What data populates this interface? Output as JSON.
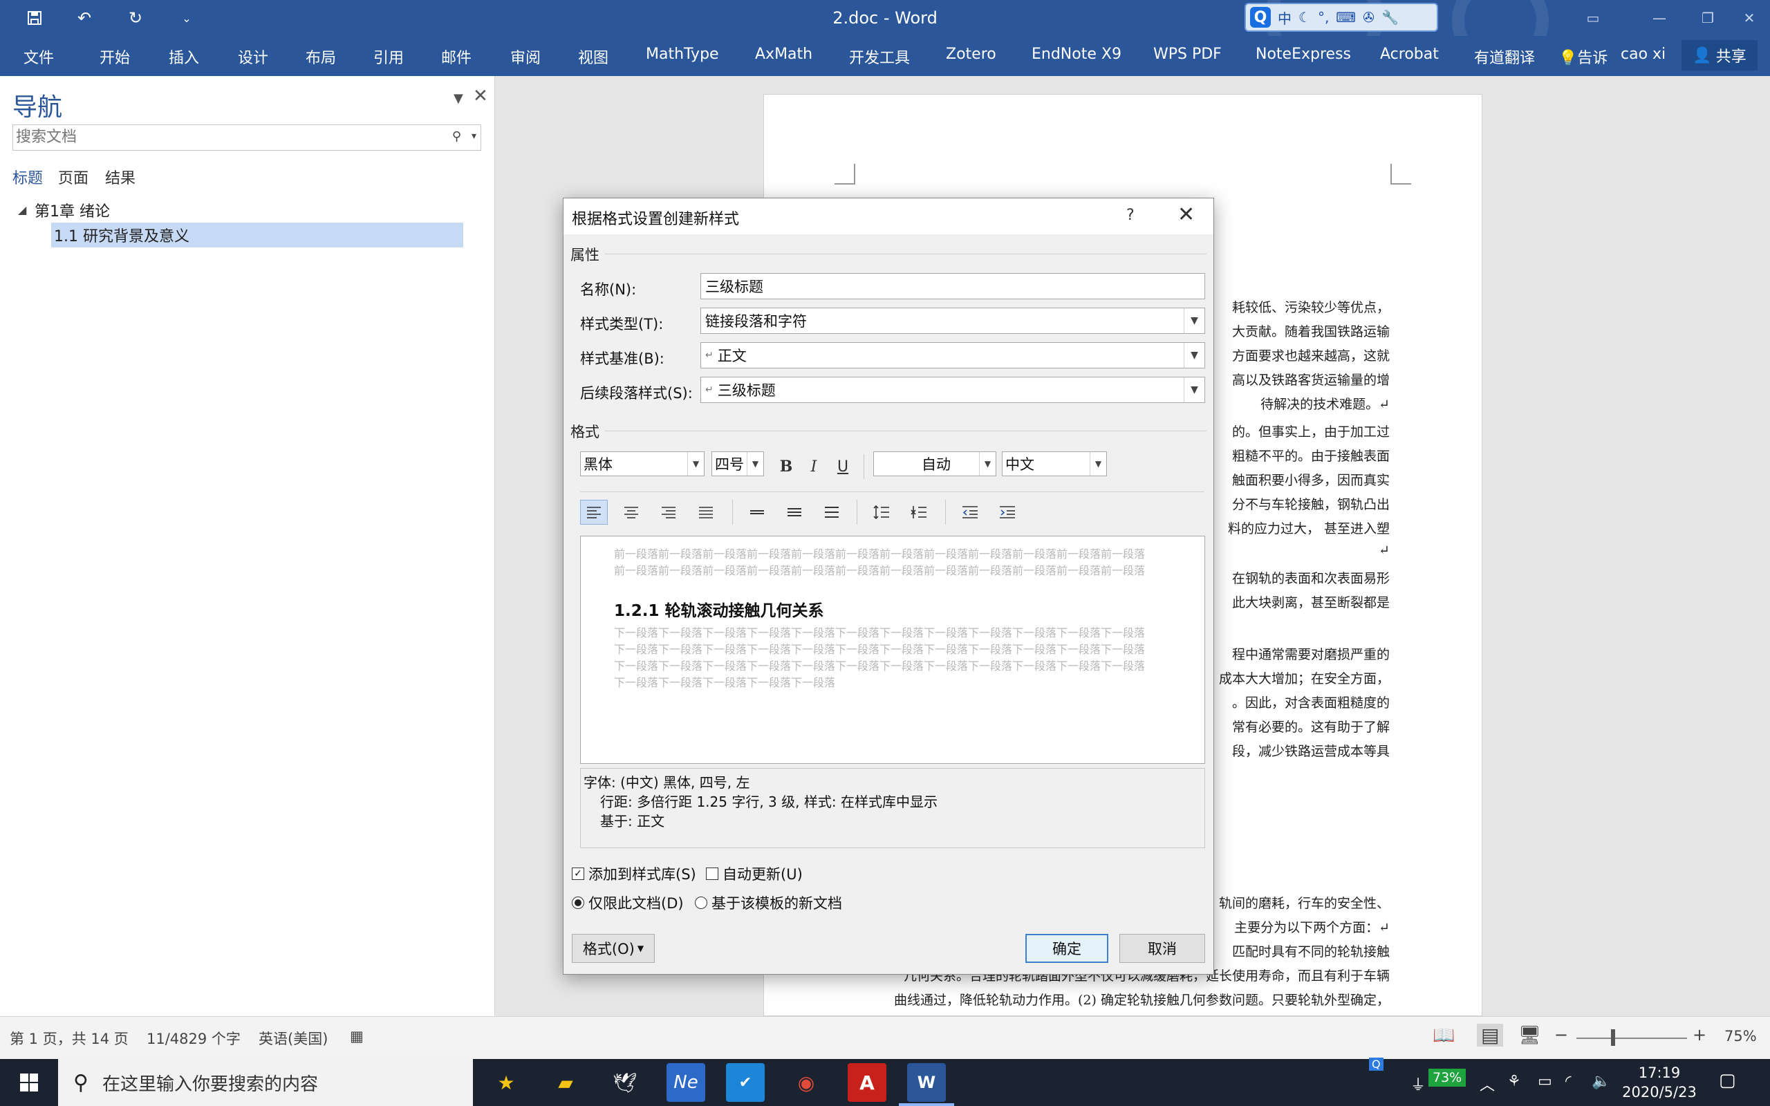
{
  "window": {
    "title": "2.doc - Word",
    "qa_more": "⌄"
  },
  "ime": {
    "q": "Q",
    "zh": "中"
  },
  "ribbon": {
    "tabs": [
      "文件",
      "开始",
      "插入",
      "设计",
      "布局",
      "引用",
      "邮件",
      "审阅",
      "视图",
      "MathType",
      "AxMath",
      "开发工具",
      "Zotero",
      "EndNote X9",
      "WPS PDF",
      "NoteExpress",
      "Acrobat",
      "有道翻译"
    ],
    "tell_me": "告诉",
    "user": "cao xi",
    "share": "共享"
  },
  "nav": {
    "title": "导航",
    "search_placeholder": "搜索文档",
    "tabs": [
      "标题",
      "页面",
      "结果"
    ],
    "tree": [
      {
        "label": "第1章 绪论"
      },
      {
        "label": "1.1 研究背景及意义"
      }
    ]
  },
  "doc": {
    "lines": [
      "耗较低、污染较少等优点，",
      "大贡献。随着我国铁路运输",
      "方面要求也越来越高，这就",
      "高以及铁路客货运输量的增",
      "待解决的技术难题。↵",
      "的。但事实上，由于加工过",
      "粗糙不平的。由于接触表面",
      "触面积要小得多，因而真实",
      "分不与车轮接触，钢轨凸出",
      "料的应力过大，  甚至进入塑",
      "↵",
      "在钢轨的表面和次表面易形",
      "此大块剥离，甚至断裂都是",
      "程中通常需要对磨损严重的",
      "成本大大增加；在安全方面，",
      "。因此，对含表面粗糙度的",
      "常有必要的。这有助于了解",
      "段，减少铁路运营成本等具",
      "轨间的磨耗，行车的安全性、",
      "主要分为以下两个方面：↵",
      "匹配时具有不同的轮轨接触",
      "几何关系。合理的轮轨踏面外型不仅可以减缓磨耗，延长使用寿命，而且有利于车辆",
      "曲线通过，降低轮轨动力作用。(2) 确定轮轨接触几何参数问题。只要轮轨外型确定，"
    ]
  },
  "status": {
    "page": "第 1 页，共 14 页",
    "words": "11/4829 个字",
    "lang": "英语(美国)",
    "zoom": "75%"
  },
  "taskbar": {
    "search": "在这里输入你要搜索的内容",
    "battery": "73%",
    "time": "17:19",
    "date": "2020/5/23"
  },
  "dialog": {
    "title": "根据格式设置创建新样式",
    "help": "?",
    "section_props": "属性",
    "name_label": "名称(N):",
    "name_value": "三级标题",
    "type_label": "样式类型(T):",
    "type_value": "链接段落和字符",
    "based_label": "样式基准(B):",
    "based_value": "正文",
    "next_label": "后续段落样式(S):",
    "next_value": "三级标题",
    "section_format": "格式",
    "font": "黑体",
    "size": "四号",
    "bold": "B",
    "italic": "I",
    "underline": "U",
    "color": "自动",
    "script": "中文",
    "preview_prev": "前一段落前一段落前一段落前一段落前一段落前一段落前一段落前一段落前一段落前一段落前一段落前一段落前一段落前一段落前一段落前一段落前一段落前一段落前一段落前一段落前一段落前一段落前一段落前一段落",
    "preview_heading": "1.2.1 轮轨滚动接触几何关系",
    "preview_next": "下一段落下一段落下一段落下一段落下一段落下一段落下一段落下一段落下一段落下一段落下一段落下一段落下一段落下一段落下一段落下一段落下一段落下一段落下一段落下一段落下一段落下一段落下一段落下一段落下一段落下一段落下一段落下一段落下一段落下一段落下一段落下一段落下一段落下一段落下一段落下一段落下一段落下一段落下一段落下一段落下一段落",
    "desc1": "字体: (中文) 黑体, 四号, 左",
    "desc2": "行距: 多倍行距 1.25 字行, 3 级, 样式: 在样式库中显示",
    "desc3": "基于: 正文",
    "add_gallery": "添加到样式库(S)",
    "auto_update": "自动更新(U)",
    "this_doc": "仅限此文档(D)",
    "template": "基于该模板的新文档",
    "format_btn": "格式(O)",
    "ok": "确定",
    "cancel": "取消"
  }
}
